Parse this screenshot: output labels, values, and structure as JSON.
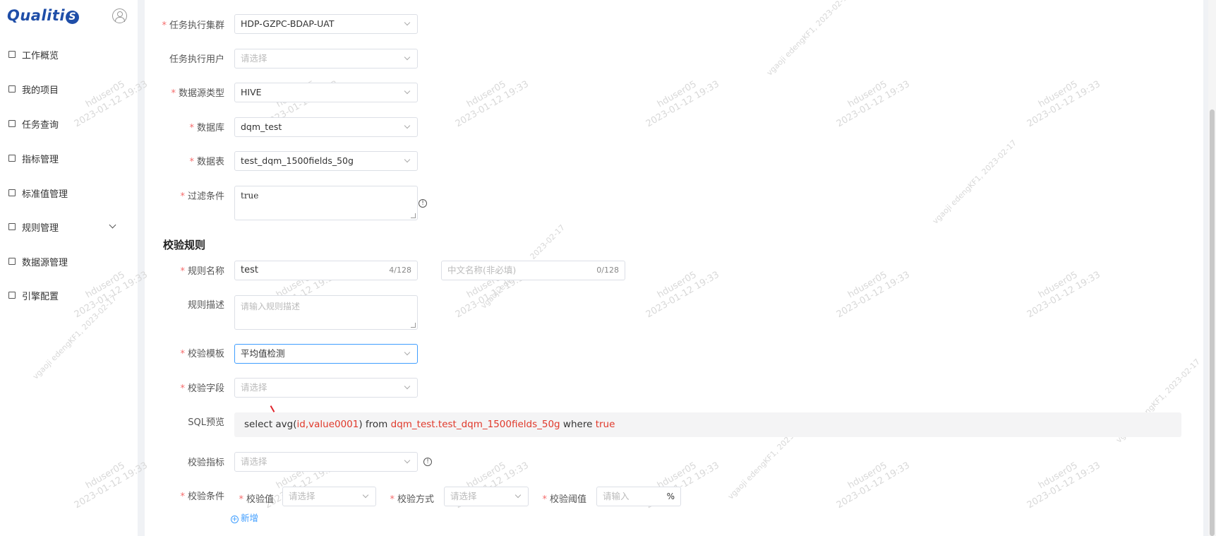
{
  "sidebar": {
    "logo_text": "Qualiti",
    "logo_circle": "S",
    "items": [
      {
        "label": "工作概览"
      },
      {
        "label": "我的项目"
      },
      {
        "label": "任务查询"
      },
      {
        "label": "指标管理"
      },
      {
        "label": "标准值管理"
      },
      {
        "label": "规则管理"
      },
      {
        "label": "数据源管理"
      },
      {
        "label": "引擎配置"
      }
    ]
  },
  "form": {
    "cluster": {
      "label": "任务执行集群",
      "value": "HDP-GZPC-BDAP-UAT"
    },
    "exec_user": {
      "label": "任务执行用户",
      "placeholder": "请选择"
    },
    "ds_type": {
      "label": "数据源类型",
      "value": "HIVE"
    },
    "database": {
      "label": "数据库",
      "value": "dqm_test"
    },
    "table": {
      "label": "数据表",
      "value": "test_dqm_1500fields_50g"
    },
    "filter": {
      "label": "过滤条件",
      "value": "true"
    }
  },
  "rules": {
    "section_title": "校验规则",
    "name": {
      "label": "规则名称",
      "value": "test",
      "count": "4/128"
    },
    "cn_name": {
      "placeholder": "中文名称(非必填)",
      "count": "0/128"
    },
    "desc": {
      "label": "规则描述",
      "placeholder": "请输入规则描述"
    },
    "template": {
      "label": "校验模板",
      "value": "平均值检测"
    },
    "field": {
      "label": "校验字段",
      "placeholder": "请选择"
    },
    "sql": {
      "label": "SQL预览",
      "p1": "select avg(",
      "p2": "id,value0001",
      "p3": ") from ",
      "p4": "dqm_test.test_dqm_1500fields_50g",
      "p5": " where ",
      "p6": "true"
    },
    "metric": {
      "label": "校验指标",
      "placeholder": "请选择"
    },
    "condition": {
      "label": "校验条件",
      "value_label": "校验值",
      "value_placeholder": "请选择",
      "method_label": "校验方式",
      "method_placeholder": "请选择",
      "threshold_label": "校验阈值",
      "threshold_placeholder": "请输入",
      "threshold_unit": "%",
      "add": "新增"
    }
  },
  "watermark": {
    "user": "hduser05",
    "time": "2023-01-12 19:33",
    "alt": "vgaoji edengKF1, 2023-02-17"
  },
  "colors": {
    "required": "#f56c6c",
    "sql_highlight": "#e0392b",
    "link": "#409eff",
    "brand": "#1f4ea8"
  }
}
